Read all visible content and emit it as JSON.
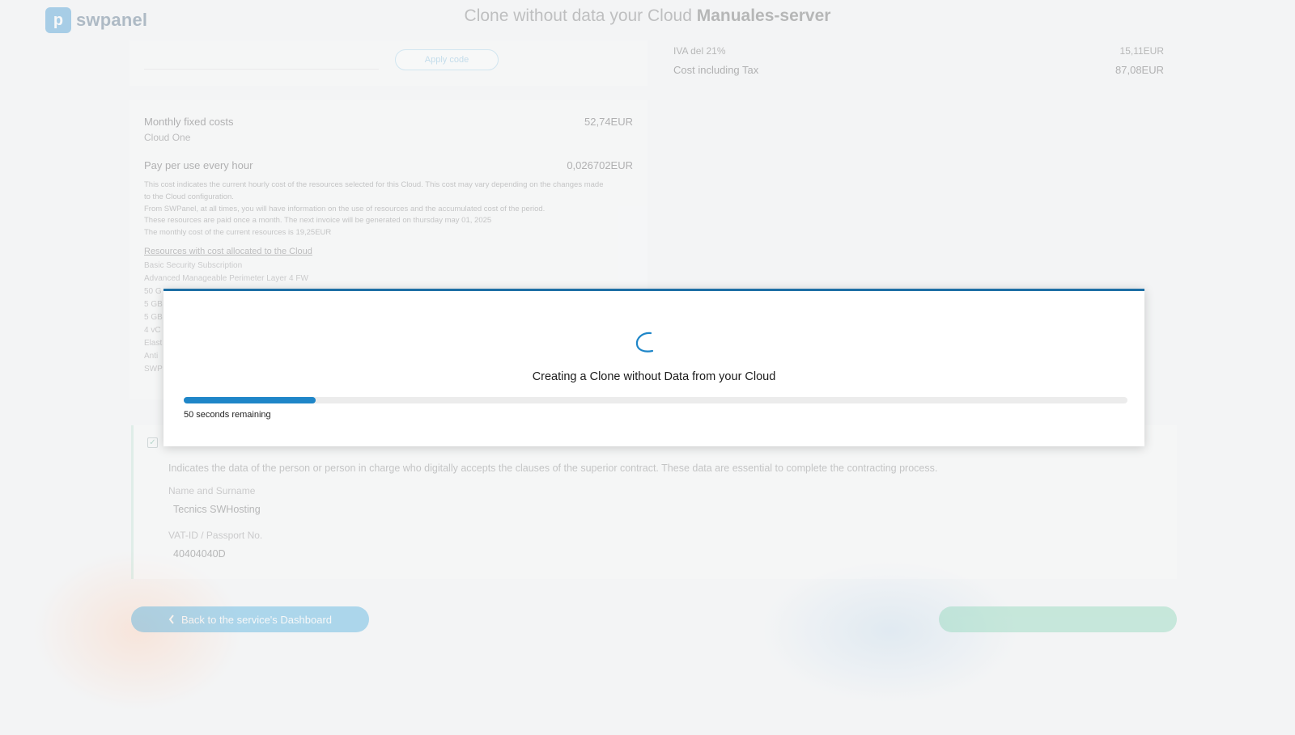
{
  "app": {
    "logo_text": "swpanel",
    "logo_mark": "p"
  },
  "page": {
    "title_prefix": "Clone without data your Cloud ",
    "title_server": "Manuales-server"
  },
  "coupon": {
    "placeholder": "",
    "button_label": "Apply code"
  },
  "taxes": {
    "iva_label": "IVA del 21%",
    "iva_value": "15,11EUR",
    "total_label": "Cost including Tax",
    "total_value": "87,08EUR"
  },
  "costs": {
    "monthly_label": "Monthly fixed costs",
    "monthly_value": "52,74EUR",
    "monthly_sub": "Cloud One",
    "hourly_label": "Pay per use every hour",
    "hourly_value": "0,026702EUR",
    "note_lines": [
      "This cost indicates the current hourly cost of the resources selected for this Cloud. This cost may vary depending on the changes made",
      "to the Cloud configuration.",
      "From SWPanel, at all times, you will have information on the use of resources and the accumulated cost of the period.",
      "These resources are paid once a month. The next invoice will be generated on thursday may 01, 2025",
      "The monthly cost of the current resources is 19,25EUR"
    ],
    "resources_link": "Resources with cost allocated to the Cloud",
    "resources": [
      "Basic Security Subscription",
      "Advanced Manageable Perimeter Layer 4 FW",
      "50 G",
      "5 GB",
      "5 GB",
      "4 vC",
      "Elast",
      "Anti",
      "SWP"
    ]
  },
  "contract": {
    "check_mark": "✓",
    "note": "Indicates the data of the person or person in charge who digitally accepts the clauses of the superior contract. These data are essential to complete the contracting process.",
    "name_label": "Name and Surname",
    "name_value": "Tecnics SWHosting",
    "vat_label": "VAT-ID / Passport No.",
    "vat_value": "40404040D"
  },
  "actions": {
    "back_label": "Back to the service's Dashboard",
    "back_icon": "chevron-left-icon",
    "next_label": ""
  },
  "modal": {
    "title": "Creating a Clone without Data from your Cloud",
    "progress": 0.14,
    "remaining_text": "50 seconds remaining",
    "accent_color": "#1d6fa5",
    "progress_color": "#1f86c8"
  }
}
